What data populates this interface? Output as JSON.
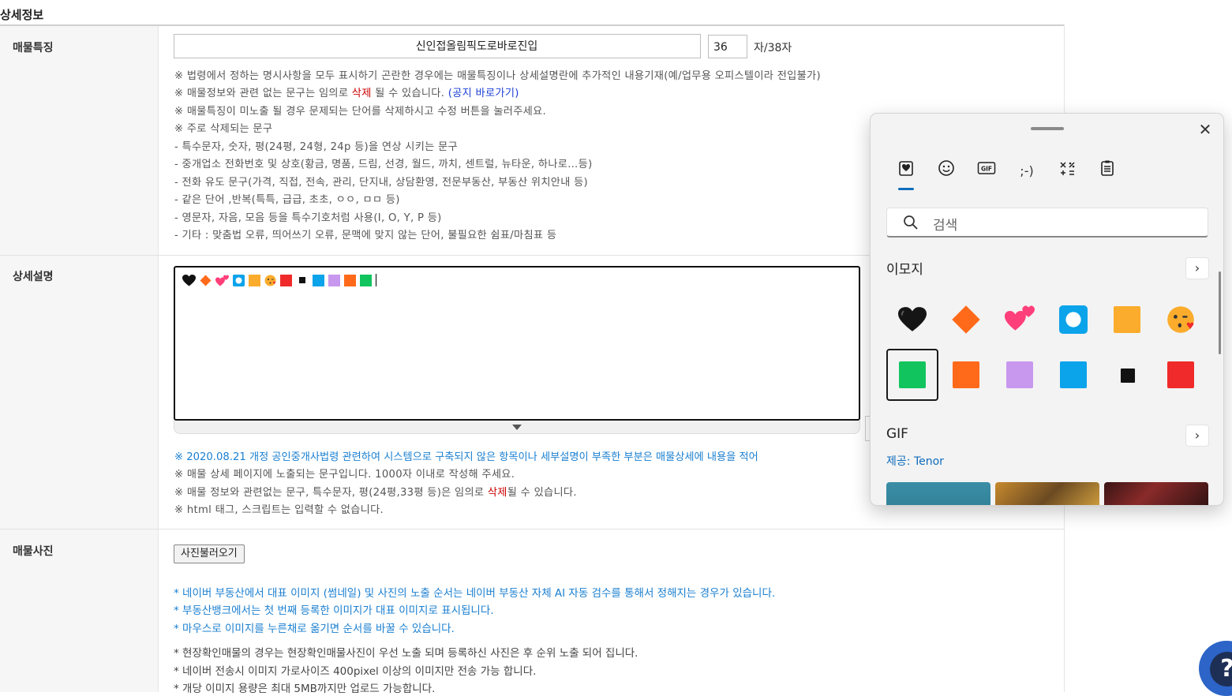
{
  "section_title": "상세정보",
  "features": {
    "label": "매물특징",
    "value": "신인접올림픽도로바로진입",
    "char_count": "36",
    "char_suffix": "자/38자",
    "notes": [
      "※ 법령에서 정하는 명시사항을 모두 표시하기 곤란한 경우에는 매물특징이나 상세설명란에 추가적인 내용기재(예/업무용 오피스텔이라 전입불가)",
      "※ 매물정보와 관련 없는 문구는 임의로 ",
      "※ 매물특징이 미노출 될 경우 문제되는 단어를 삭제하시고 수정 버튼을 눌러주세요.",
      "※ 주로 삭제되는 문구",
      " - 특수문자, 숫자, 평(24평, 24형, 24p 등)을 연상 시키는 문구",
      " - 중개업소 전화번호 및 상호(황금, 명품, 드림, 선경, 월드, 까치, 센트럴, 뉴타운, 하나로…등)",
      " - 전화 유도 문구(가격, 직접, 전속, 관리, 단지내, 상담환영, 전문부동산, 부동산 위치안내 등)",
      " - 같은 단어 ,반복(특특, 급급, 초초, ㅇㅇ, ㅁㅁ 등)",
      " - 영문자, 자음, 모음 등을 특수기호처럼 사용(I, O, Y, P 등)",
      " - 기타 : 맞춤법 오류, 띄어쓰기 오류, 문맥에 맞지 않는 단어, 불필요한 쉼표/마침표 등"
    ],
    "note2_delete": "삭제",
    "note2_tail": " 될 수 있습니다. ",
    "note2_link": "(공지 바로가기)"
  },
  "description": {
    "label": "상세설명",
    "notes": {
      "blue": "※ 2020.08.21 개정 공인중개사법령 관련하여 시스템으로 구축되지 않은 항목이나 세부설명이 부족한 부분은 매물상세에 내용을 적어",
      "n2": "※ 매물 상세 페이지에 노출되는 문구입니다. 1000자 이내로 작성해 주세요.",
      "n3_head": "※ 매물 정보와 관련없는 문구, 특수문자, 평(24평,33평 등)은 임의로 ",
      "n3_delete": "삭제",
      "n3_tail": "될 수 있습니다.",
      "n4": "※ html 태그, 스크립트는 입력할 수 없습니다."
    }
  },
  "photos": {
    "label": "매물사진",
    "button": "사진불러오기",
    "blue_notes": [
      "* 네이버 부동산에서 대표 이미지 (썸네일) 및 사진의 노출 순서는 네이버 부동산 자체 AI 자동 검수를 통해서 정해지는 경우가 있습니다.",
      "* 부동산뱅크에서는 첫 번째 등록한 이미지가 대표 이미지로 표시됩니다.",
      "* 마우스로 이미지를 누른채로 옮기면 순서를 바꿀 수 있습니다."
    ],
    "gray_notes": [
      "* 현장확인매물의 경우는 현장확인매물사진이 우선 노출 되며 등록하신 사진은 후 순위 노출 되어 집니다.",
      "* 네이버 전송시 이미지 가로사이즈 400pixel 이상의 이미지만 전송 가능 합니다.",
      "* 개당 이미지 용량은 최대 5MB까지만 업로드 가능합니다."
    ]
  },
  "emoji_panel": {
    "close": "✕",
    "tabs": [
      "favorites",
      "emoji",
      "GIF",
      ";-)",
      "symbols",
      "clipboard"
    ],
    "tab_labels": {
      "gif": "GIF",
      "kaomoji": ";-)"
    },
    "search_placeholder": "검색",
    "emoji_heading": "이모지",
    "gif_heading": "GIF",
    "provider_prefix": "제공: ",
    "provider": "Tenor",
    "chevron": "›",
    "colors": {
      "green": "#11c45d",
      "orange": "#ff6a1a",
      "purple": "#c897ee",
      "blue": "#0ba3ea",
      "black": "#111111",
      "red": "#f02a2a",
      "yellow": "#fbac2c",
      "pink": "#ff3f7a",
      "accent": "#0f6cbd"
    }
  },
  "help": {
    "glyph": "?"
  }
}
